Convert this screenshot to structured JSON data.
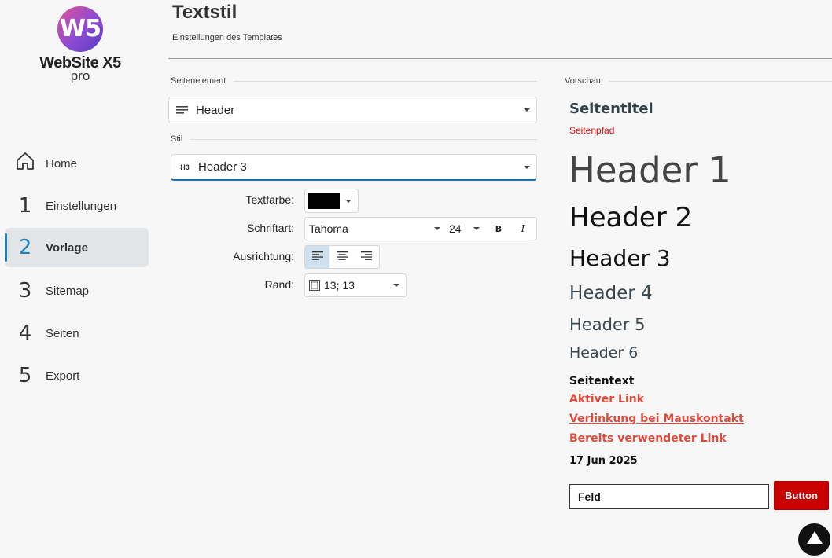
{
  "app": {
    "logo_mark": "W5",
    "logo_brand": "WebSite X5",
    "logo_sub": "pro"
  },
  "sidebar": {
    "items": [
      {
        "num": "",
        "label": "Home",
        "icon": "home-icon"
      },
      {
        "num": "1",
        "label": "Einstellungen"
      },
      {
        "num": "2",
        "label": "Vorlage",
        "active": true
      },
      {
        "num": "3",
        "label": "Sitemap"
      },
      {
        "num": "4",
        "label": "Seiten"
      },
      {
        "num": "5",
        "label": "Export"
      }
    ]
  },
  "header": {
    "title": "Textstil",
    "subtitle": "Einstellungen des Templates"
  },
  "form": {
    "seitenelement_label": "Seitenelement",
    "seitenelement_value": "Header",
    "stil_label": "Stil",
    "stil_icon_text": "H3",
    "stil_value": "Header 3",
    "textfarbe_label": "Textfarbe:",
    "textfarbe_color": "#000000",
    "schriftart_label": "Schriftart:",
    "font_value": "Tahoma",
    "size_value": "24",
    "bold_label": "B",
    "italic_label": "I",
    "ausrichtung_label": "Ausrichtung:",
    "rand_label": "Rand:",
    "rand_value": "13; 13"
  },
  "preview": {
    "label": "Vorschau",
    "seitentitel": "Seitentitel",
    "seitenpfad": "Seitenpfad",
    "h1": "Header 1",
    "h2": "Header 2",
    "h3": "Header 3",
    "h4": "Header 4",
    "h5": "Header 5",
    "h6": "Header 6",
    "seitentext": "Seitentext",
    "aktiver_link": "Aktiver Link",
    "hover_link": "Verlinkung bei Mauskontakt",
    "visited_link": "Bereits verwendeter Link",
    "date": "17 Jun 2025",
    "field": "Feld",
    "button": "Button"
  },
  "colors": {
    "accent": "#1f7fbf",
    "link": "#e04a3a",
    "button": "#c80000"
  }
}
